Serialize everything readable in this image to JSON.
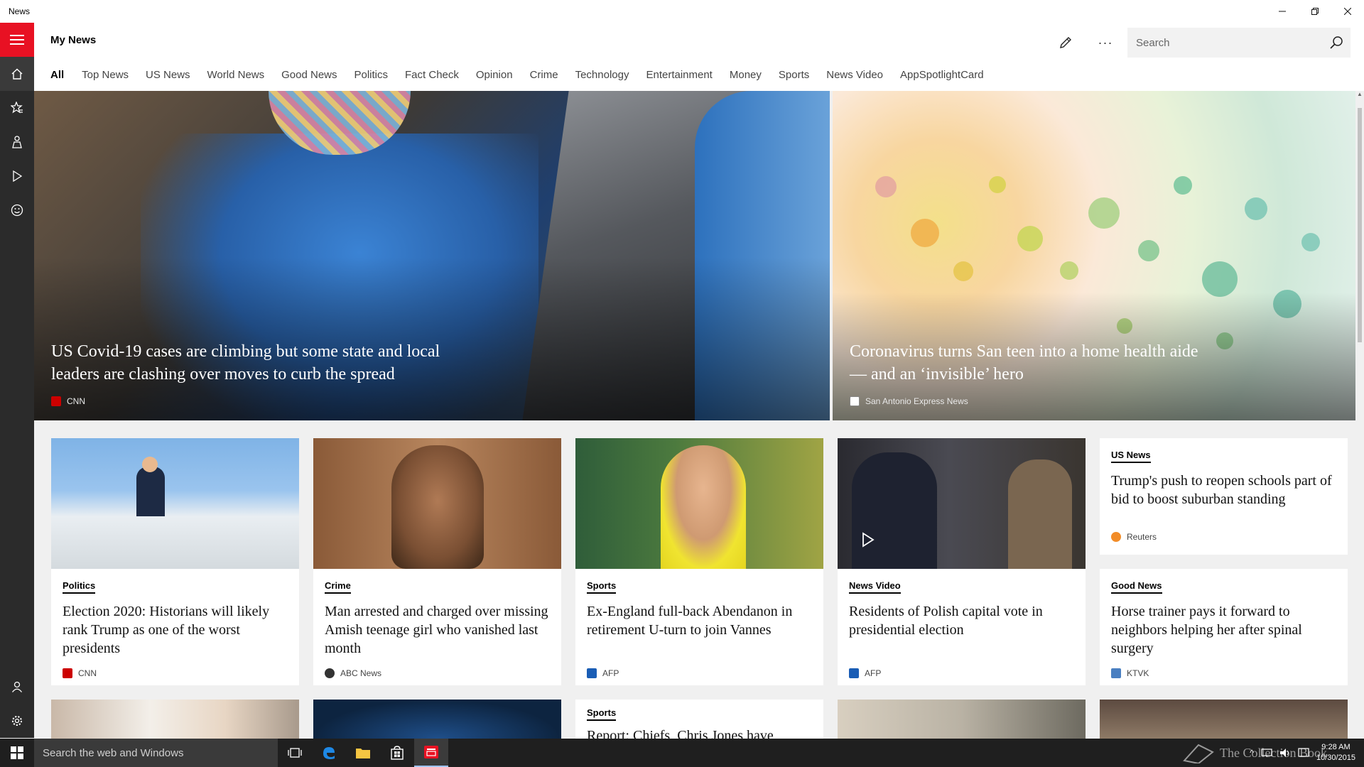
{
  "window": {
    "title": "News"
  },
  "header": {
    "page_title": "My News",
    "search_placeholder": "Search",
    "tabs": [
      "All",
      "Top News",
      "US News",
      "World News",
      "Good News",
      "Politics",
      "Fact Check",
      "Opinion",
      "Crime",
      "Technology",
      "Entertainment",
      "Money",
      "Sports",
      "News Video",
      "AppSpotlightCard"
    ]
  },
  "rail": {
    "items": [
      "menu-icon",
      "home-icon",
      "favorites-icon",
      "interests-icon",
      "video-icon",
      "feedback-icon"
    ],
    "bottom": [
      "account-icon",
      "settings-icon"
    ]
  },
  "hero": [
    {
      "headline": "US Covid-19 cases are climbing but some state and local leaders are clashing over moves to curb the spread",
      "source": "CNN",
      "source_color": "#cc0000"
    },
    {
      "headline": "Coronavirus turns San teen into a home health aide — and an ‘invisible’ hero",
      "source": "San Antonio Express News",
      "source_color": "#555555"
    }
  ],
  "cards": [
    {
      "category": "Politics",
      "title": "Election 2020: Historians will likely rank Trump as one of the worst presidents",
      "source": "CNN"
    },
    {
      "category": "Crime",
      "title": "Man arrested and charged over missing Amish teenage girl who vanished last month",
      "source": "ABC News"
    },
    {
      "category": "Sports",
      "title": "Ex-England full-back Abendanon in retirement U-turn to join Vannes",
      "source": "AFP"
    },
    {
      "category": "News Video",
      "title": "Residents of Polish capital vote in presidential election",
      "source": "AFP"
    },
    {
      "category": "US News",
      "title": "Trump's push to reopen schools part of bid to boost suburban standing",
      "source": "Reuters"
    },
    {
      "category": "Good News",
      "title": "Horse trainer pays it forward to neighbors helping her after spinal surgery",
      "source": "KTVK"
    },
    {
      "category": "Sports",
      "title": "Report: Chiefs, Chris Jones have"
    }
  ],
  "taskbar": {
    "search_text": "Search the web and Windows",
    "time": "9:28 AM",
    "date": "10/30/2015",
    "watermark": "The Collection Book"
  }
}
